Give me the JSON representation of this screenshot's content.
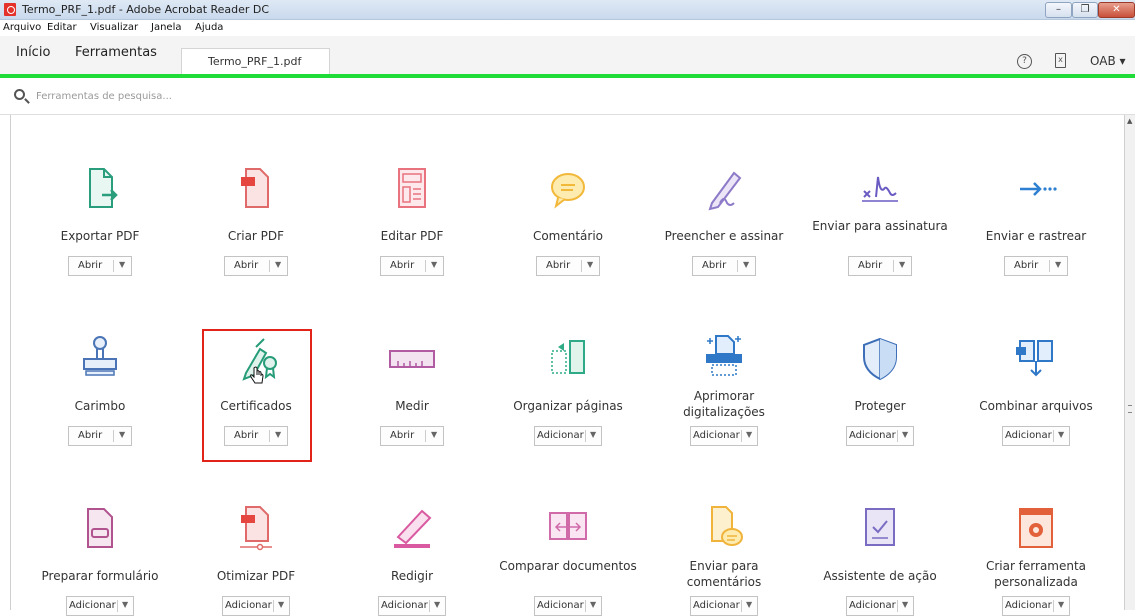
{
  "window": {
    "title": "Termo_PRF_1.pdf - Adobe Acrobat Reader DC"
  },
  "menu": [
    "Arquivo",
    "Editar",
    "Visualizar",
    "Janela",
    "Ajuda"
  ],
  "tabs": {
    "home": "Início",
    "tools": "Ferramentas",
    "document": "Termo_PRF_1.pdf"
  },
  "header": {
    "help": "?",
    "mobile": "x",
    "account": "OAB ▾"
  },
  "search": {
    "placeholder": "Ferramentas de pesquisa..."
  },
  "tools": [
    {
      "label": "Exportar PDF",
      "action": "Abrir",
      "icon": "export-pdf-icon"
    },
    {
      "label": "Criar PDF",
      "action": "Abrir",
      "icon": "create-pdf-icon"
    },
    {
      "label": "Editar PDF",
      "action": "Abrir",
      "icon": "edit-pdf-icon"
    },
    {
      "label": "Comentário",
      "action": "Abrir",
      "icon": "comment-icon"
    },
    {
      "label": "Preencher e assinar",
      "action": "Abrir",
      "icon": "fill-sign-icon"
    },
    {
      "label": "Enviar para assinatura",
      "action": "Abrir",
      "icon": "send-signature-icon"
    },
    {
      "label": "Enviar e rastrear",
      "action": "Abrir",
      "icon": "send-track-icon"
    },
    {
      "label": "Carimbo",
      "action": "Abrir",
      "icon": "stamp-icon"
    },
    {
      "label": "Certificados",
      "action": "Abrir",
      "icon": "certificates-icon"
    },
    {
      "label": "Medir",
      "action": "Abrir",
      "icon": "measure-icon"
    },
    {
      "label": "Organizar páginas",
      "action": "Adicionar",
      "icon": "organize-pages-icon"
    },
    {
      "label": "Aprimorar digitalizações",
      "action": "Adicionar",
      "icon": "enhance-scans-icon"
    },
    {
      "label": "Proteger",
      "action": "Adicionar",
      "icon": "protect-icon"
    },
    {
      "label": "Combinar arquivos",
      "action": "Adicionar",
      "icon": "combine-files-icon"
    },
    {
      "label": "Preparar formulário",
      "action": "Adicionar",
      "icon": "prepare-form-icon"
    },
    {
      "label": "Otimizar PDF",
      "action": "Adicionar",
      "icon": "optimize-pdf-icon"
    },
    {
      "label": "Redigir",
      "action": "Adicionar",
      "icon": "redact-icon"
    },
    {
      "label": "Comparar documentos",
      "action": "Adicionar",
      "icon": "compare-documents-icon"
    },
    {
      "label": "Enviar para comentários",
      "action": "Adicionar",
      "icon": "send-comments-icon"
    },
    {
      "label": "Assistente de ação",
      "action": "Adicionar",
      "icon": "action-wizard-icon"
    },
    {
      "label": "Criar ferramenta personalizada",
      "action": "Adicionar",
      "icon": "custom-tool-icon"
    }
  ],
  "colors": {
    "accent_green": "#1fdc38",
    "highlight_red": "#e2231a"
  }
}
